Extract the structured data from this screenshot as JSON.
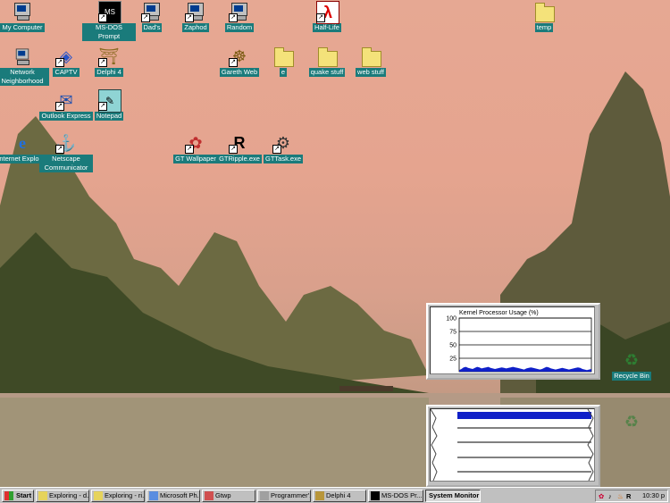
{
  "desktop": {
    "icons": [
      {
        "label": "My Computer",
        "kind": "computer"
      },
      {
        "label": "MS-DOS Prompt",
        "kind": "msdos"
      },
      {
        "label": "Dad's",
        "kind": "computer"
      },
      {
        "label": "Zaphod",
        "kind": "computer"
      },
      {
        "label": "Random",
        "kind": "computer"
      },
      {
        "label": "Half-Life",
        "kind": "halflife"
      },
      {
        "label": "temp",
        "kind": "folder"
      },
      {
        "label": "Network Neighborhood",
        "kind": "network"
      },
      {
        "label": "CAPTV",
        "kind": "captv"
      },
      {
        "label": "Delphi 4",
        "kind": "delphi"
      },
      {
        "label": "Gareth Web",
        "kind": "web"
      },
      {
        "label": "e",
        "kind": "folder"
      },
      {
        "label": "quake stuff",
        "kind": "folder"
      },
      {
        "label": "web stuff",
        "kind": "folder"
      },
      {
        "label": "Outlook Express",
        "kind": "outlook"
      },
      {
        "label": "Notepad",
        "kind": "notepad"
      },
      {
        "label": "Internet Explorer",
        "kind": "ie"
      },
      {
        "label": "Netscape Communicator",
        "kind": "netscape"
      },
      {
        "label": "GT Wallpaper",
        "kind": "gtwall"
      },
      {
        "label": "GTRipple.exe",
        "kind": "ripple"
      },
      {
        "label": "GTTask.exe",
        "kind": "gear"
      },
      {
        "label": "Recycle Bin",
        "kind": "recycle"
      }
    ]
  },
  "kernel_monitor": {
    "title": "Kernel Processor Usage (%)",
    "y_ticks": [
      "100",
      "75",
      "50",
      "25"
    ],
    "usage_samples": [
      3,
      5,
      8,
      9,
      7,
      6,
      5,
      7,
      9,
      8,
      6,
      7,
      8,
      9,
      7,
      6,
      5,
      6,
      7,
      8,
      7,
      6,
      7,
      8,
      9,
      8,
      7,
      6,
      5,
      4,
      6,
      7,
      8,
      7,
      6,
      5,
      4,
      5,
      7,
      9,
      8,
      6,
      5,
      4,
      5,
      6,
      7,
      6,
      5,
      4,
      5,
      6,
      7,
      8,
      7,
      5,
      4,
      3,
      4,
      5
    ]
  },
  "taskbar": {
    "start_label": "Start",
    "buttons": [
      {
        "label": "Exploring - d..."
      },
      {
        "label": "Exploring - ri..."
      },
      {
        "label": "Microsoft Ph..."
      },
      {
        "label": "Gtwp"
      },
      {
        "label": "Programmer'..."
      },
      {
        "label": "Delphi 4"
      },
      {
        "label": "MS-DOS Pr..."
      },
      {
        "label": "System Monitor"
      }
    ],
    "clock": "10:30 p"
  }
}
